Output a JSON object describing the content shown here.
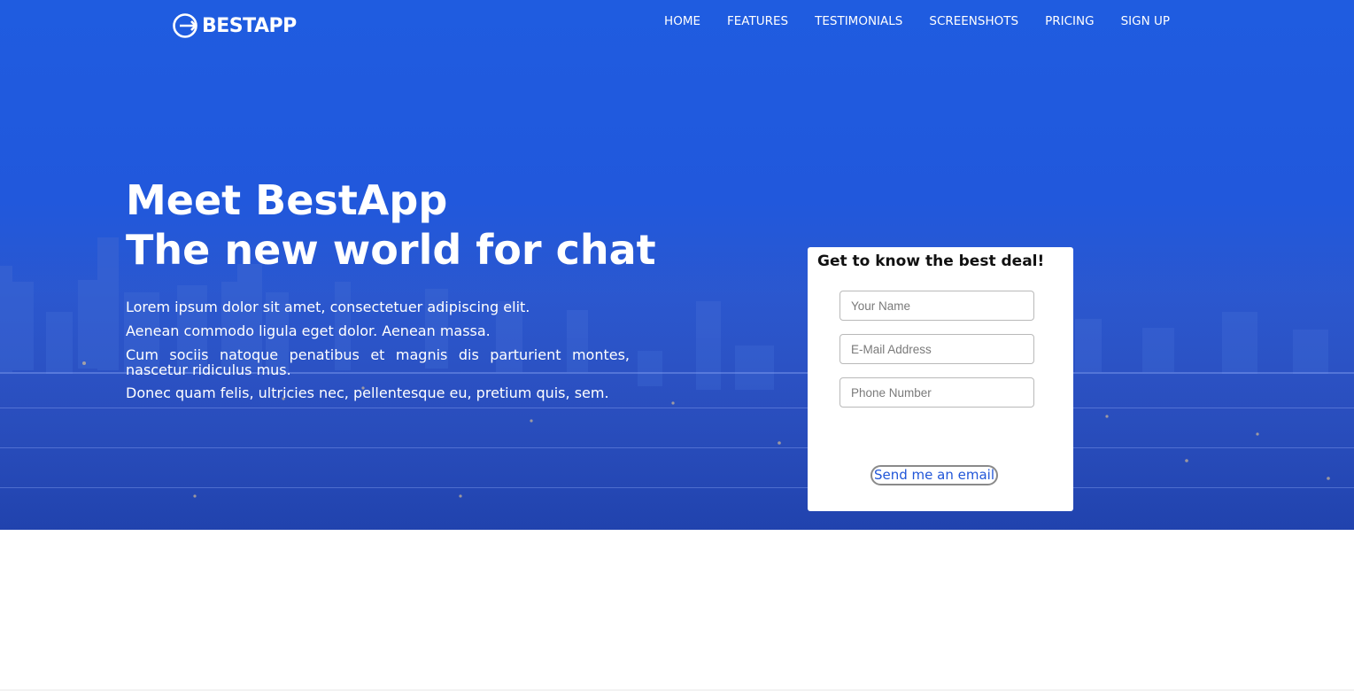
{
  "brand": {
    "logo_icon": "arrow-circle-icon",
    "name": "BESTAPP"
  },
  "nav": {
    "items": [
      "HOME",
      "FEATURES",
      "TESTIMONIALS",
      "SCREENSHOTS",
      "PRICING",
      "SIGN UP"
    ]
  },
  "hero": {
    "headline_line1": "Meet BestApp",
    "headline_line2": "The new world for chat",
    "paragraphs": [
      "Lorem ipsum dolor sit amet, consectetuer adipiscing elit.",
      "Aenean commodo ligula eget dolor. Aenean massa.",
      "Cum sociis natoque penatibus et magnis dis parturient montes, nascetur ridiculus mus.",
      "Donec quam felis, ultricies nec, pellentesque eu, pretium quis, sem."
    ]
  },
  "signup_form": {
    "title": "Get to know the best deal!",
    "name_placeholder": "Your Name",
    "email_placeholder": "E-Mail Address",
    "phone_placeholder": "Phone Number",
    "submit_label": "Send me an email"
  },
  "colors": {
    "hero_blue": "#2158dc",
    "link_blue": "#2156d8",
    "card_bg": "#ffffff"
  }
}
